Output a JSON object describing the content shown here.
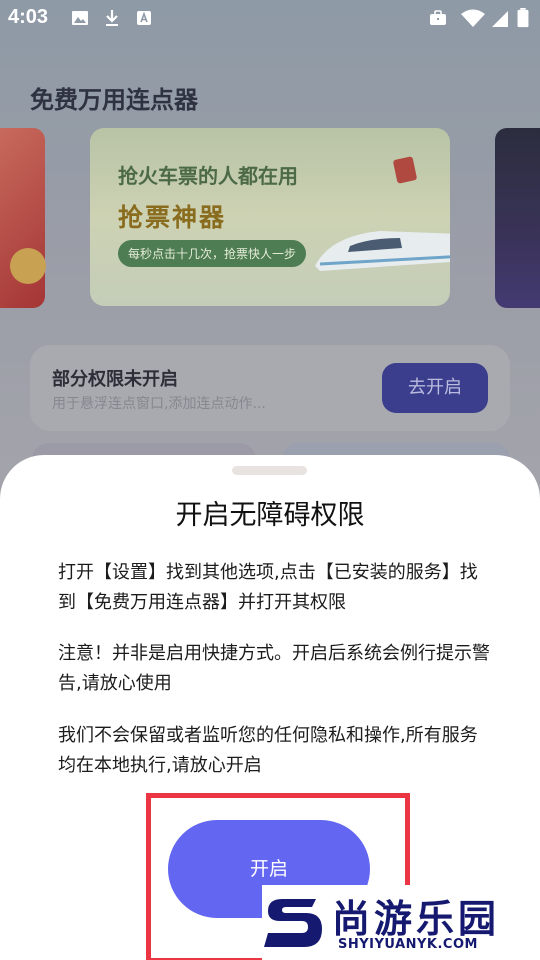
{
  "status_bar": {
    "time": "4:03",
    "left_icons": [
      "image-icon",
      "download-icon",
      "font-icon"
    ],
    "right_icons": [
      "briefcase-icon",
      "wifi-icon",
      "signal-icon",
      "battery-icon"
    ]
  },
  "app": {
    "title": "免费万用连点器"
  },
  "banner": {
    "line1": "抢火车票的人都在用",
    "line2": "抢票神器",
    "pill": "每秒点击十几次，抢票快人一步"
  },
  "permission_card": {
    "title": "部分权限未开启",
    "subtitle": "用于悬浮连点窗口,添加连点动作...",
    "button": "去开启"
  },
  "sheet": {
    "title": "开启无障碍权限",
    "paragraph1": "打开【设置】找到其他选项,点击【已安装的服务】找到【免费万用连点器】并打开其权限",
    "paragraph2": "注意！并非是启用快捷方式。开启后系统会例行提示警告,请放心使用",
    "paragraph3": "我们不会保留或者监听您的任何隐私和操作,所有服务均在本地执行,请放心开启",
    "button": "开启"
  },
  "watermark": {
    "cn": "尚游乐园",
    "en": "SHYIYUANYK.COM"
  },
  "colors": {
    "accent": "#6366f1",
    "highlight_box": "#ec3542",
    "watermark": "#151a70"
  }
}
